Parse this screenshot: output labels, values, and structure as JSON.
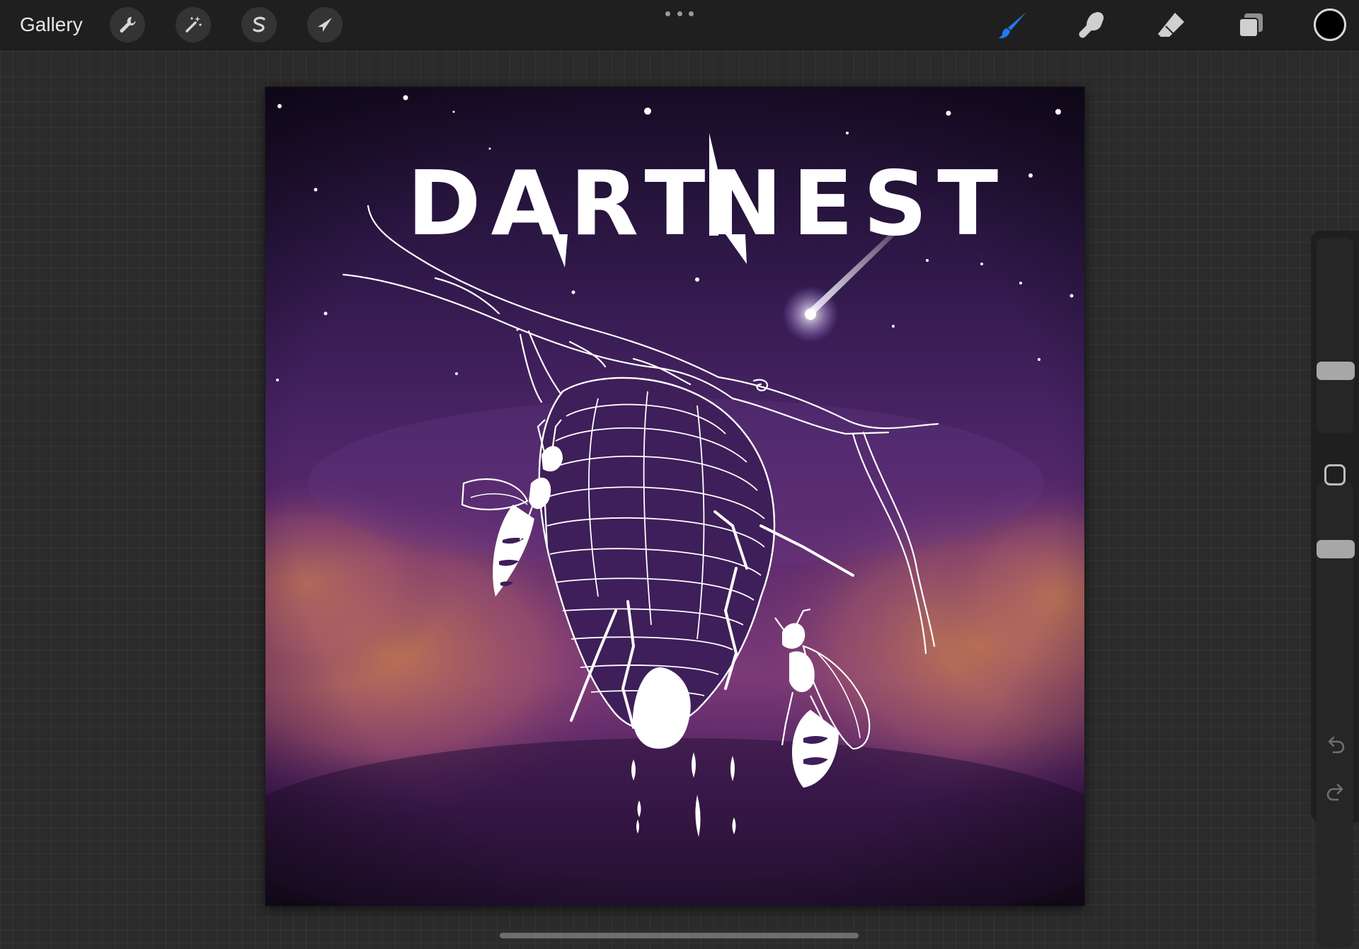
{
  "toolbar": {
    "gallery_label": "Gallery",
    "left_tools": [
      {
        "name": "actions",
        "icon": "wrench-icon"
      },
      {
        "name": "adjustments",
        "icon": "magic-wand-icon"
      },
      {
        "name": "selection",
        "icon": "selection-s-icon"
      },
      {
        "name": "transform",
        "icon": "arrow-cursor-icon"
      }
    ],
    "more_icon": "ellipsis-icon",
    "right_tools": [
      {
        "name": "brush",
        "icon": "brush-icon",
        "active": true
      },
      {
        "name": "smudge",
        "icon": "smudge-finger-icon",
        "active": false
      },
      {
        "name": "eraser",
        "icon": "eraser-icon",
        "active": false
      },
      {
        "name": "layers",
        "icon": "layers-icon",
        "active": false
      }
    ],
    "current_color": "#000000",
    "active_tool_color": "#1f7bea"
  },
  "artwork": {
    "title_word_1": "DART",
    "title_word_2": "NEST",
    "subject": "paper wasp nest hanging from branch with wasps, shooting star, purple night sky"
  },
  "sidebar": {
    "brush_size_level": 0.3,
    "opacity_level": 0.12,
    "modify_icon": "square-icon",
    "undo_icon": "undo-arrow-icon",
    "redo_icon": "redo-arrow-icon"
  }
}
